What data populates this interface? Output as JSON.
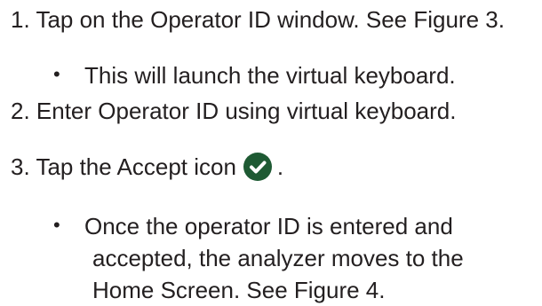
{
  "instructions": {
    "step1": "1. Tap on the Operator ID window. See Figure 3.",
    "step1_bullet": "This will launch the virtual keyboard.",
    "step2": "2. Enter Operator ID using virtual keyboard.",
    "step3_prefix": "3. Tap the Accept icon",
    "step3_suffix": ".",
    "step3_bullet_lines": [
      "Once the operator ID is entered and",
      "accepted, the analyzer moves to the",
      "Home Screen. See Figure 4."
    ],
    "bullet_glyph": "•"
  },
  "accept_icon": {
    "icon": "check-circle-icon",
    "color": "#1e5a33"
  }
}
